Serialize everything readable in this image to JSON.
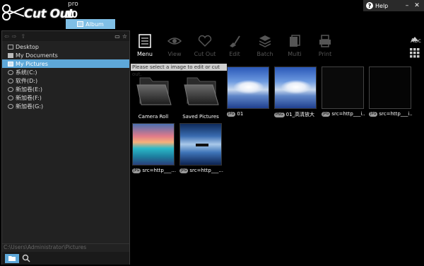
{
  "app": {
    "logo_text": "Cut Out",
    "logo_pro": "pro",
    "logo_version": "10",
    "album_tab": "Album",
    "help_label": "Help",
    "win_controls": [
      "–",
      "✕"
    ]
  },
  "sidebar": {
    "items": [
      {
        "label": "Desktop",
        "icon": "desktop-icon"
      },
      {
        "label": "My Documents",
        "icon": "documents-icon"
      },
      {
        "label": "My Pictures",
        "icon": "pictures-icon",
        "selected": true
      },
      {
        "label": "系统(C:)",
        "icon": "drive-icon"
      },
      {
        "label": "软件(D:)",
        "icon": "drive-icon"
      },
      {
        "label": "新加卷(E:)",
        "icon": "drive-icon"
      },
      {
        "label": "新加卷(F:)",
        "icon": "drive-icon"
      },
      {
        "label": "新加卷(G:)",
        "icon": "drive-icon"
      }
    ],
    "path": "C:\\Users\\Administrator\\Pictures"
  },
  "toolbar": {
    "menu": "Menu",
    "view": "View",
    "cutout": "Cut Out",
    "edit": "Edit",
    "batch": "Batch",
    "multi": "Multi",
    "print": "Print"
  },
  "hint": "Please select a image to edit or cut out.",
  "abc_label": "Abc",
  "gallery": {
    "folders": [
      {
        "label": "Camera Roll"
      },
      {
        "label": "Saved Pictures"
      }
    ],
    "images": [
      {
        "caption": "01",
        "tag": "JPG"
      },
      {
        "caption": "01_高清放大",
        "tag": "PNG"
      },
      {
        "caption": "src=http___i...",
        "tag": "JPG"
      },
      {
        "caption": "src=http___i...",
        "tag": "JPG"
      },
      {
        "caption": "src=http___...",
        "tag": "JPG"
      },
      {
        "caption": "src=http___...",
        "tag": "JPG"
      }
    ]
  }
}
